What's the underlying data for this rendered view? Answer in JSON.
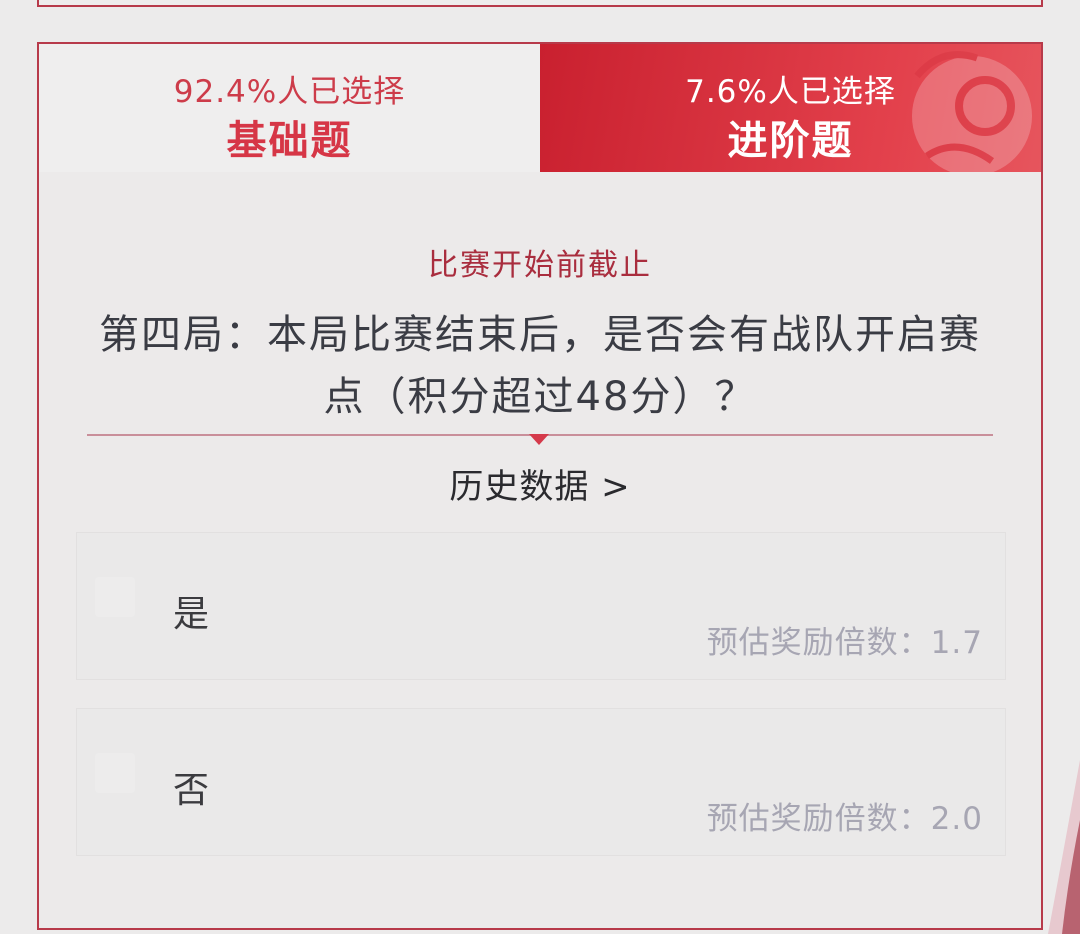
{
  "tabs": [
    {
      "percent_label": "92.4%人已选择",
      "title": "基础题",
      "selected": false
    },
    {
      "percent_label": "7.6%人已选择",
      "title": "进阶题",
      "selected": true
    }
  ],
  "question": {
    "deadline": "比赛开始前截止",
    "text": "第四局：本局比赛结束后，是否会有战队开启赛点（积分超过48分）？",
    "history_link": "历史数据 >"
  },
  "options": [
    {
      "label": "是",
      "odds": "预估奖励倍数：1.7"
    },
    {
      "label": "否",
      "odds": "预估奖励倍数：2.0"
    }
  ],
  "colors": {
    "accent": "#d63646",
    "advanced_tab": "#d3303d",
    "border": "#b73a4a",
    "odds_text": "#a7a6b3"
  }
}
